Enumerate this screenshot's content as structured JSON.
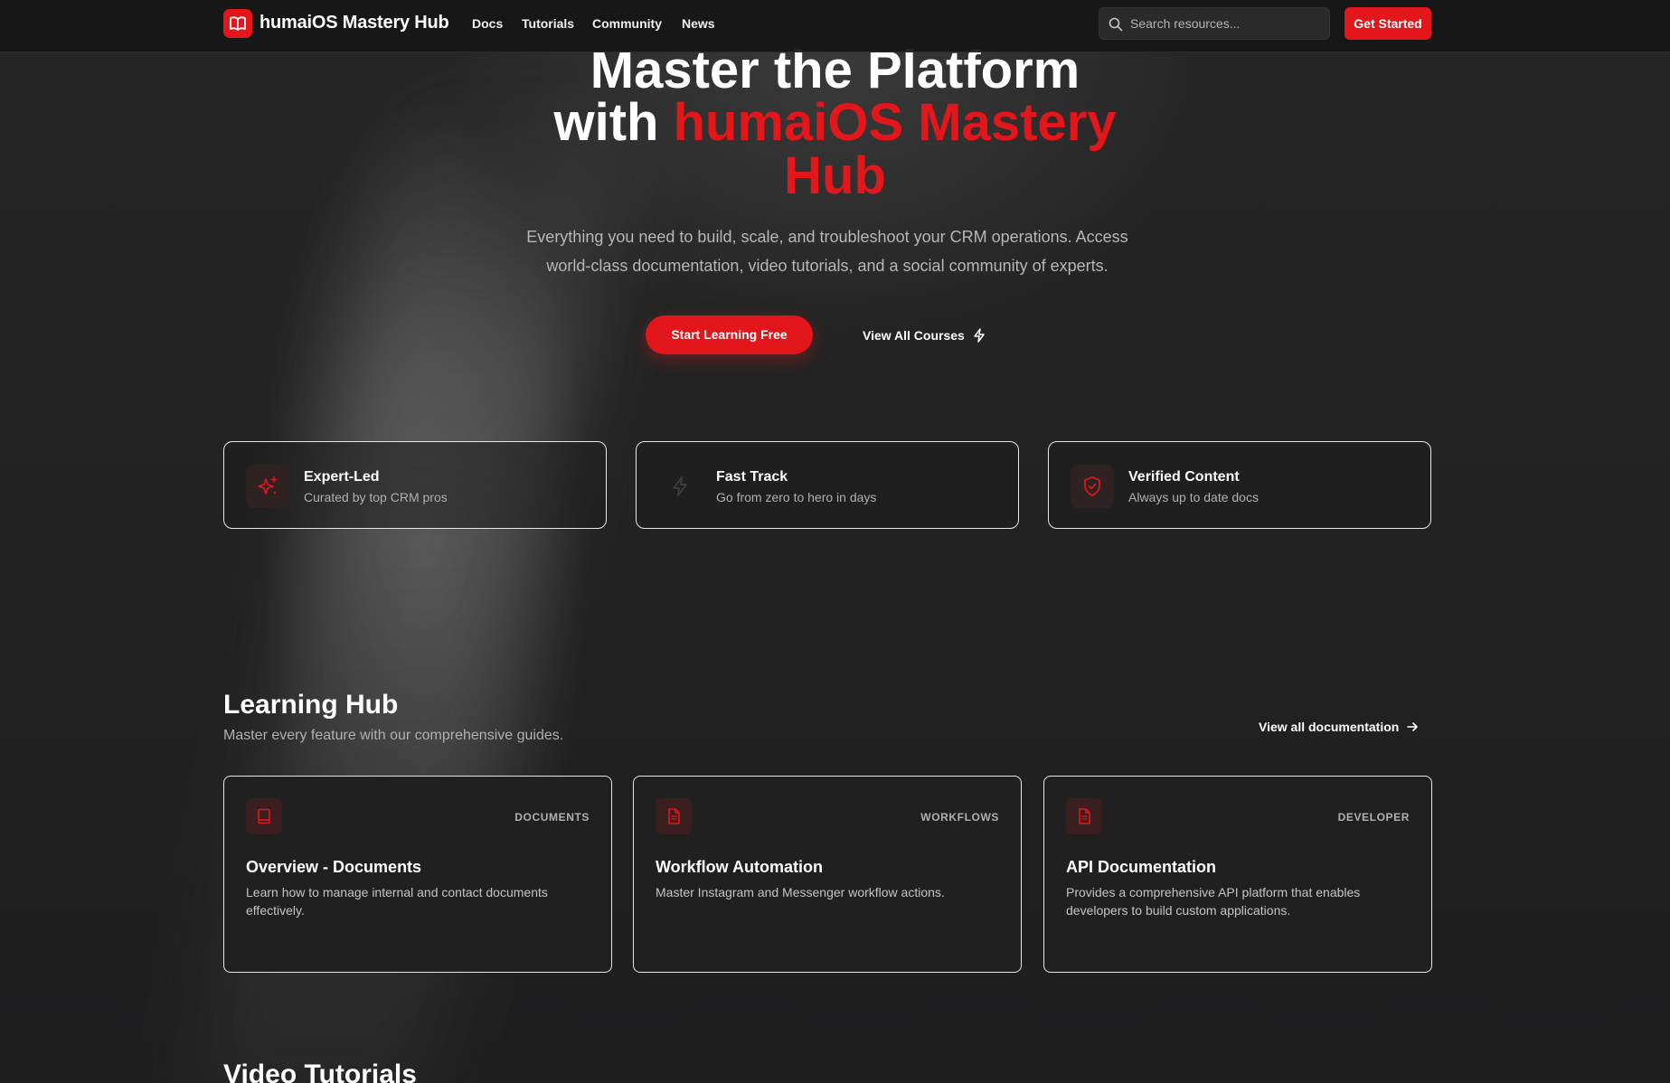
{
  "header": {
    "logo_text": "humaiOS Mastery Hub",
    "nav": [
      "Docs",
      "Tutorials",
      "Community",
      "News"
    ],
    "search_placeholder": "Search resources...",
    "cta": "Get Started"
  },
  "hero": {
    "title_line1": "Master the Platform",
    "title_with": "with",
    "title_highlight_1": "humaiOS Mastery",
    "title_highlight_2": "Hub",
    "subtitle_line1": "Everything you need to build, scale, and troubleshoot your CRM operations. Access",
    "subtitle_line2": "world-class documentation, video tutorials, and a social community of experts.",
    "primary_button": "Start Learning Free",
    "secondary_button": "View All Courses"
  },
  "features": [
    {
      "title": "Expert-Led",
      "desc": "Curated by top CRM pros",
      "icon": "sparkles-icon"
    },
    {
      "title": "Fast Track",
      "desc": "Go from zero to hero in days",
      "icon": "lightning-icon"
    },
    {
      "title": "Verified Content",
      "desc": "Always up to date docs",
      "icon": "shield-check-icon"
    }
  ],
  "learning_hub": {
    "title": "Learning Hub",
    "subtitle": "Master every feature with our comprehensive guides.",
    "link": "View all documentation",
    "cards": [
      {
        "tag": "DOCUMENTS",
        "title": "Overview - Documents",
        "desc": "Learn how to manage internal and contact documents effectively.",
        "icon": "book-icon"
      },
      {
        "tag": "WORKFLOWS",
        "title": "Workflow Automation",
        "desc": "Master Instagram and Messenger workflow actions.",
        "icon": "file-text-icon"
      },
      {
        "tag": "DEVELOPER",
        "title": "API Documentation",
        "desc": "Provides a comprehensive API platform that enables developers to build custom applications.",
        "icon": "file-text-icon"
      }
    ]
  },
  "video_tutorials": {
    "title": "Video Tutorials"
  },
  "colors": {
    "accent": "#e3161c",
    "background": "#1c1c1d",
    "text": "#ffffff",
    "muted": "#b0b0b0"
  }
}
